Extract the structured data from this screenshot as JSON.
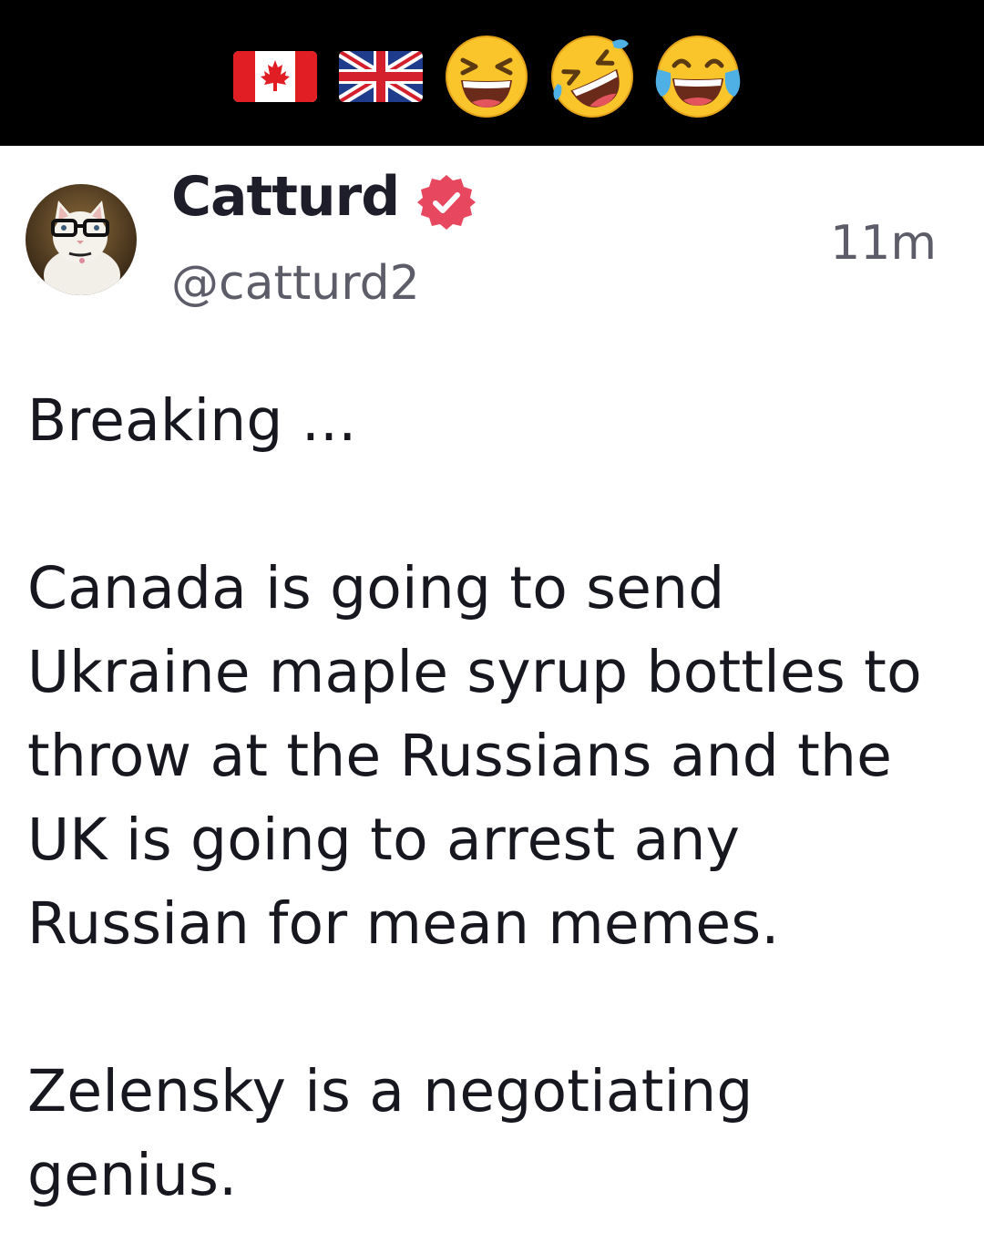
{
  "banner": {
    "background": "#000000",
    "emojis": [
      "canada-flag-icon",
      "uk-flag-icon",
      "grinning-squinting-face-icon",
      "rolling-on-the-floor-laughing-icon",
      "face-with-tears-of-joy-icon"
    ]
  },
  "post": {
    "author": {
      "display_name": "Catturd",
      "handle": "@catturd2",
      "verified": true,
      "verified_color": "#e8485f"
    },
    "time_ago": "11m",
    "body": {
      "paragraph_1": "Breaking ...",
      "paragraph_2": "Canada is going to send Ukraine maple syrup bottles to throw at the Russians and the UK is going to arrest any Russian for mean memes.",
      "paragraph_3": "Zelensky is a negotiating genius."
    }
  }
}
